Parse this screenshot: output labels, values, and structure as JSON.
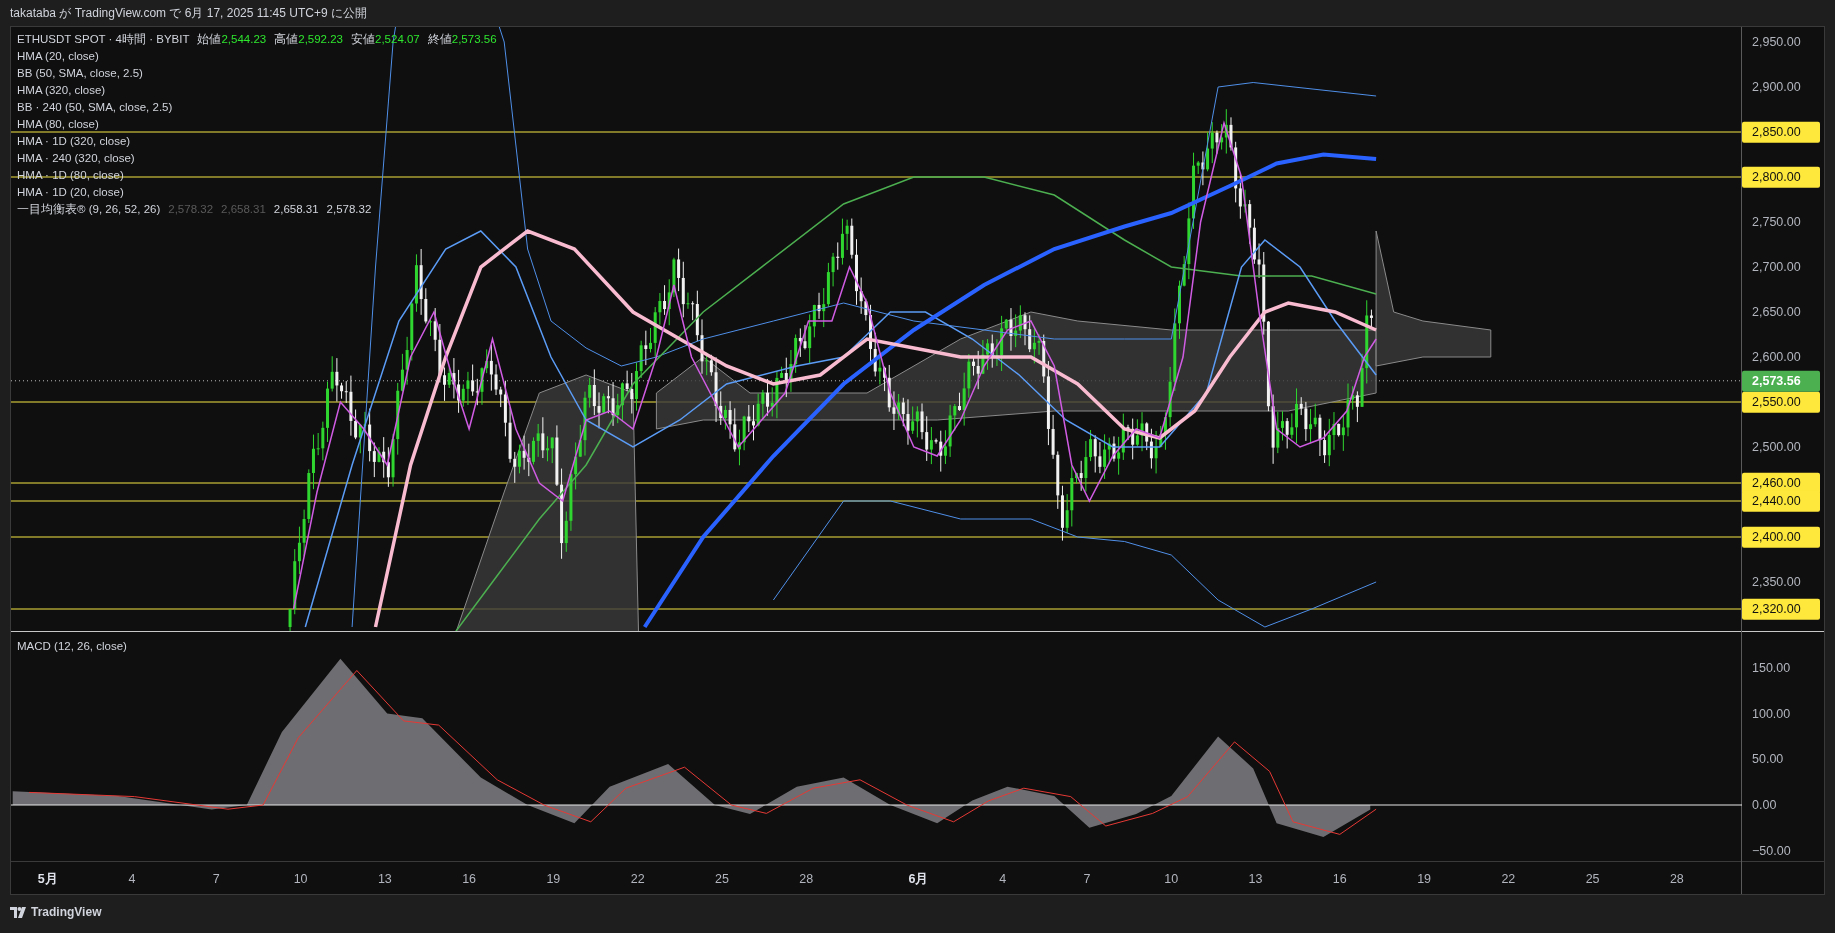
{
  "header": {
    "text": "takataba が TradingView.com で 6月 17, 2025 11:45 UTC+9 に公開"
  },
  "legend": {
    "symbol": "ETHUSDT SPOT · 4時間 · BYBIT",
    "ohlc": [
      {
        "label": "始値",
        "value": "2,544.23"
      },
      {
        "label": "高値",
        "value": "2,592.23"
      },
      {
        "label": "安値",
        "value": "2,524.07"
      },
      {
        "label": "終値",
        "value": "2,573.56"
      }
    ],
    "indicators": [
      "HMA (20, close)",
      "BB (50, SMA, close, 2.5)",
      "HMA (320, close)",
      "BB · 240 (50, SMA, close, 2.5)",
      "HMA (80, close)",
      "HMA · 1D (320, close)",
      "HMA · 240 (320, close)",
      "HMA · 1D (80, close)",
      "HMA · 1D (20, close)"
    ],
    "ichimoku": {
      "name": "一目均衡表® (9, 26, 52, 26)",
      "values": [
        {
          "text": "2,578.32",
          "muted": true
        },
        {
          "text": "2,658.31",
          "muted": true
        },
        {
          "text": "2,658.31",
          "muted": false
        },
        {
          "text": "2,578.32",
          "muted": false
        }
      ]
    }
  },
  "price_axis": {
    "ticks": [
      "2,950.00",
      "2,900.00",
      "2,750.00",
      "2,700.00",
      "2,650.00",
      "2,600.00",
      "2,500.00",
      "2,350.00"
    ],
    "price_lines": [
      "2,850.00",
      "2,800.00",
      "2,550.00",
      "2,460.00",
      "2,440.00",
      "2,400.00",
      "2,320.00"
    ],
    "current_price": "2,573.56"
  },
  "macd": {
    "title": "MACD (12, 26, close)",
    "ticks": [
      "150.00",
      "100.00",
      "50.00",
      "0.00",
      "−50.00"
    ]
  },
  "time_axis": {
    "labels": [
      {
        "text": "5月",
        "month": true
      },
      {
        "text": "4",
        "month": false
      },
      {
        "text": "7",
        "month": false
      },
      {
        "text": "10",
        "month": false
      },
      {
        "text": "13",
        "month": false
      },
      {
        "text": "16",
        "month": false
      },
      {
        "text": "19",
        "month": false
      },
      {
        "text": "22",
        "month": false
      },
      {
        "text": "25",
        "month": false
      },
      {
        "text": "28",
        "month": false
      },
      {
        "text": "6月",
        "month": true
      },
      {
        "text": "4",
        "month": false
      },
      {
        "text": "7",
        "month": false
      },
      {
        "text": "10",
        "month": false
      },
      {
        "text": "13",
        "month": false
      },
      {
        "text": "16",
        "month": false
      },
      {
        "text": "19",
        "month": false
      },
      {
        "text": "22",
        "month": false
      },
      {
        "text": "25",
        "month": false
      },
      {
        "text": "28",
        "month": false
      }
    ]
  },
  "footer": {
    "logo": "TradingView"
  }
}
